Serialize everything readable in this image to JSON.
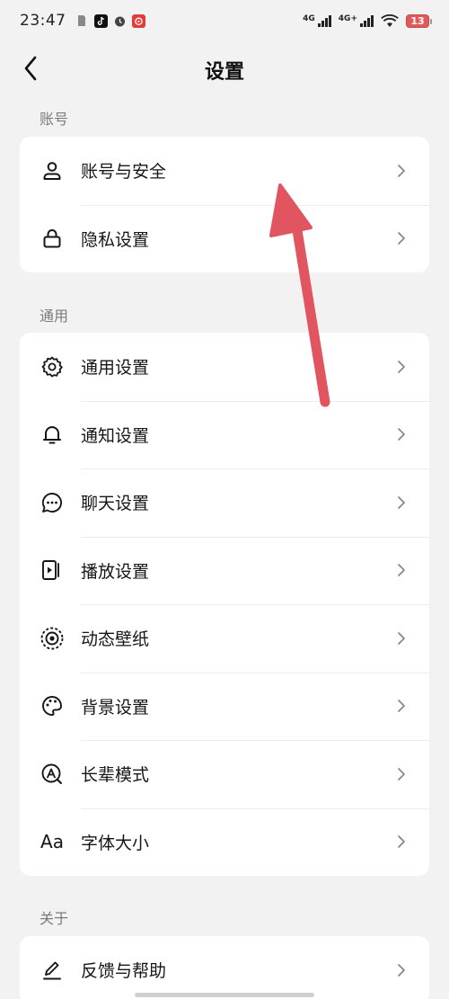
{
  "status_bar": {
    "time": "23:47",
    "net1_label": "4G",
    "net2_label": "4G+",
    "battery": "13"
  },
  "header": {
    "title": "设置"
  },
  "sections": [
    {
      "label": "账号",
      "items": [
        {
          "label": "账号与安全",
          "icon": "user-icon"
        },
        {
          "label": "隐私设置",
          "icon": "lock-icon"
        }
      ]
    },
    {
      "label": "通用",
      "items": [
        {
          "label": "通用设置",
          "icon": "gear-icon"
        },
        {
          "label": "通知设置",
          "icon": "bell-icon"
        },
        {
          "label": "聊天设置",
          "icon": "chat-bubble-icon"
        },
        {
          "label": "播放设置",
          "icon": "play-card-icon"
        },
        {
          "label": "动态壁纸",
          "icon": "wallpaper-icon"
        },
        {
          "label": "背景设置",
          "icon": "palette-icon"
        },
        {
          "label": "长辈模式",
          "icon": "elder-mode-icon"
        },
        {
          "label": "字体大小",
          "icon": "font-size-icon",
          "glyph": "Aa"
        }
      ]
    },
    {
      "label": "关于",
      "items": [
        {
          "label": "反馈与帮助",
          "icon": "pen-icon"
        }
      ]
    }
  ],
  "colors": {
    "background": "#f2f2f2",
    "card": "#ffffff",
    "annotation_arrow": "#e05560"
  }
}
